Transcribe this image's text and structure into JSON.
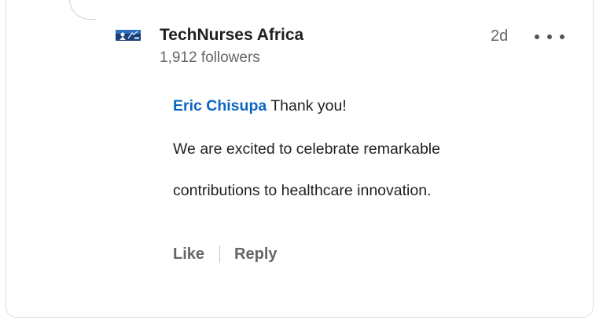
{
  "comment": {
    "author": {
      "name": "TechNurses Africa",
      "followers": "1,912 followers",
      "avatar_icon": "technurses-logo-icon"
    },
    "timestamp": "2d",
    "more_icon": "ellipsis-icon",
    "mention": "Eric Chisupa",
    "mention_suffix": " Thank you!",
    "body_line_1": "We are excited to celebrate remarkable",
    "body_line_2": "contributions to healthcare innovation."
  },
  "actions": {
    "like_label": "Like",
    "reply_label": "Reply"
  },
  "colors": {
    "mention": "#0a66c2",
    "primary_text": "#1f1f1f",
    "secondary_text": "#666666"
  }
}
